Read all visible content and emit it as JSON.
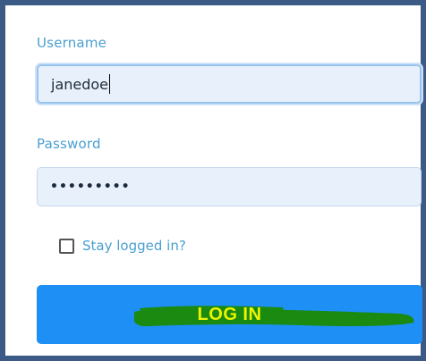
{
  "form": {
    "username": {
      "label": "Username",
      "value": "janedoe"
    },
    "password": {
      "label": "Password",
      "masked_value": "•••••••••"
    },
    "stay_logged_in": {
      "label": "Stay logged in?",
      "checked": false
    },
    "login_button": {
      "label": "LOG IN"
    }
  },
  "colors": {
    "frame_border": "#3b5a86",
    "label_text": "#4a9fd0",
    "input_background": "#e8f0fb",
    "button_background": "#1e8ff4",
    "button_text": "#ecf400",
    "highlight_marker": "#1a8a10"
  }
}
